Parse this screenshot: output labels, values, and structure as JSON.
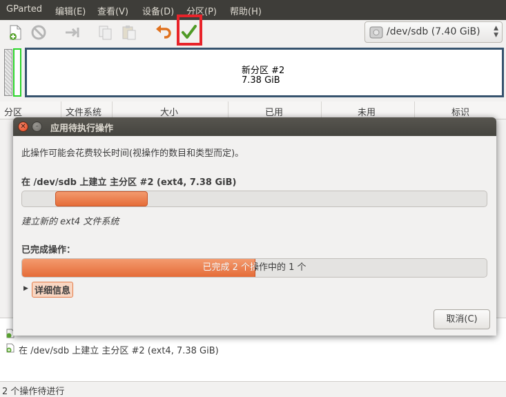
{
  "menubar": {
    "items": [
      "GParted",
      "编辑(E)",
      "查看(V)",
      "设备(D)",
      "分区(P)",
      "帮助(H)"
    ]
  },
  "toolbar": {
    "buttons": [
      "new-partition-icon",
      "delete-icon",
      "resize-move-icon",
      "copy-icon",
      "paste-icon",
      "undo-icon",
      "apply-icon"
    ],
    "device": "/dev/sdb  (7.40 GiB)"
  },
  "partition_graphic": {
    "name": "新分区 #2",
    "size": "7.38 GiB"
  },
  "table": {
    "columns": [
      "分区",
      "文件系统",
      "大小",
      "已用",
      "未用",
      "标识"
    ]
  },
  "pending_ops": {
    "items": [
      "在 /dev/sdb 上建立 主分区 #2 (ext4, 7.38 GiB)"
    ]
  },
  "statusbar": {
    "text": "2 个操作待进行"
  },
  "dialog": {
    "title": "应用待执行操作",
    "message": "此操作可能会花费较长时间(视操作的数目和类型而定)。",
    "current_op": "在 /dev/sdb 上建立 主分区 #2 (ext4, 7.38 GiB)",
    "current_subop": "建立新的 ext4 文件系统",
    "completed_label": "已完成操作：",
    "progress_text": "已完成 2 个操作中的 1 个",
    "progress_fraction": 0.5,
    "details_label": "详细信息",
    "cancel_label": "取消(C)"
  },
  "colors": {
    "menubar_bg": "#3e3d39",
    "accent_orange": "#e56c38",
    "highlight_red": "#e8232a",
    "selection_green": "#28d428"
  }
}
